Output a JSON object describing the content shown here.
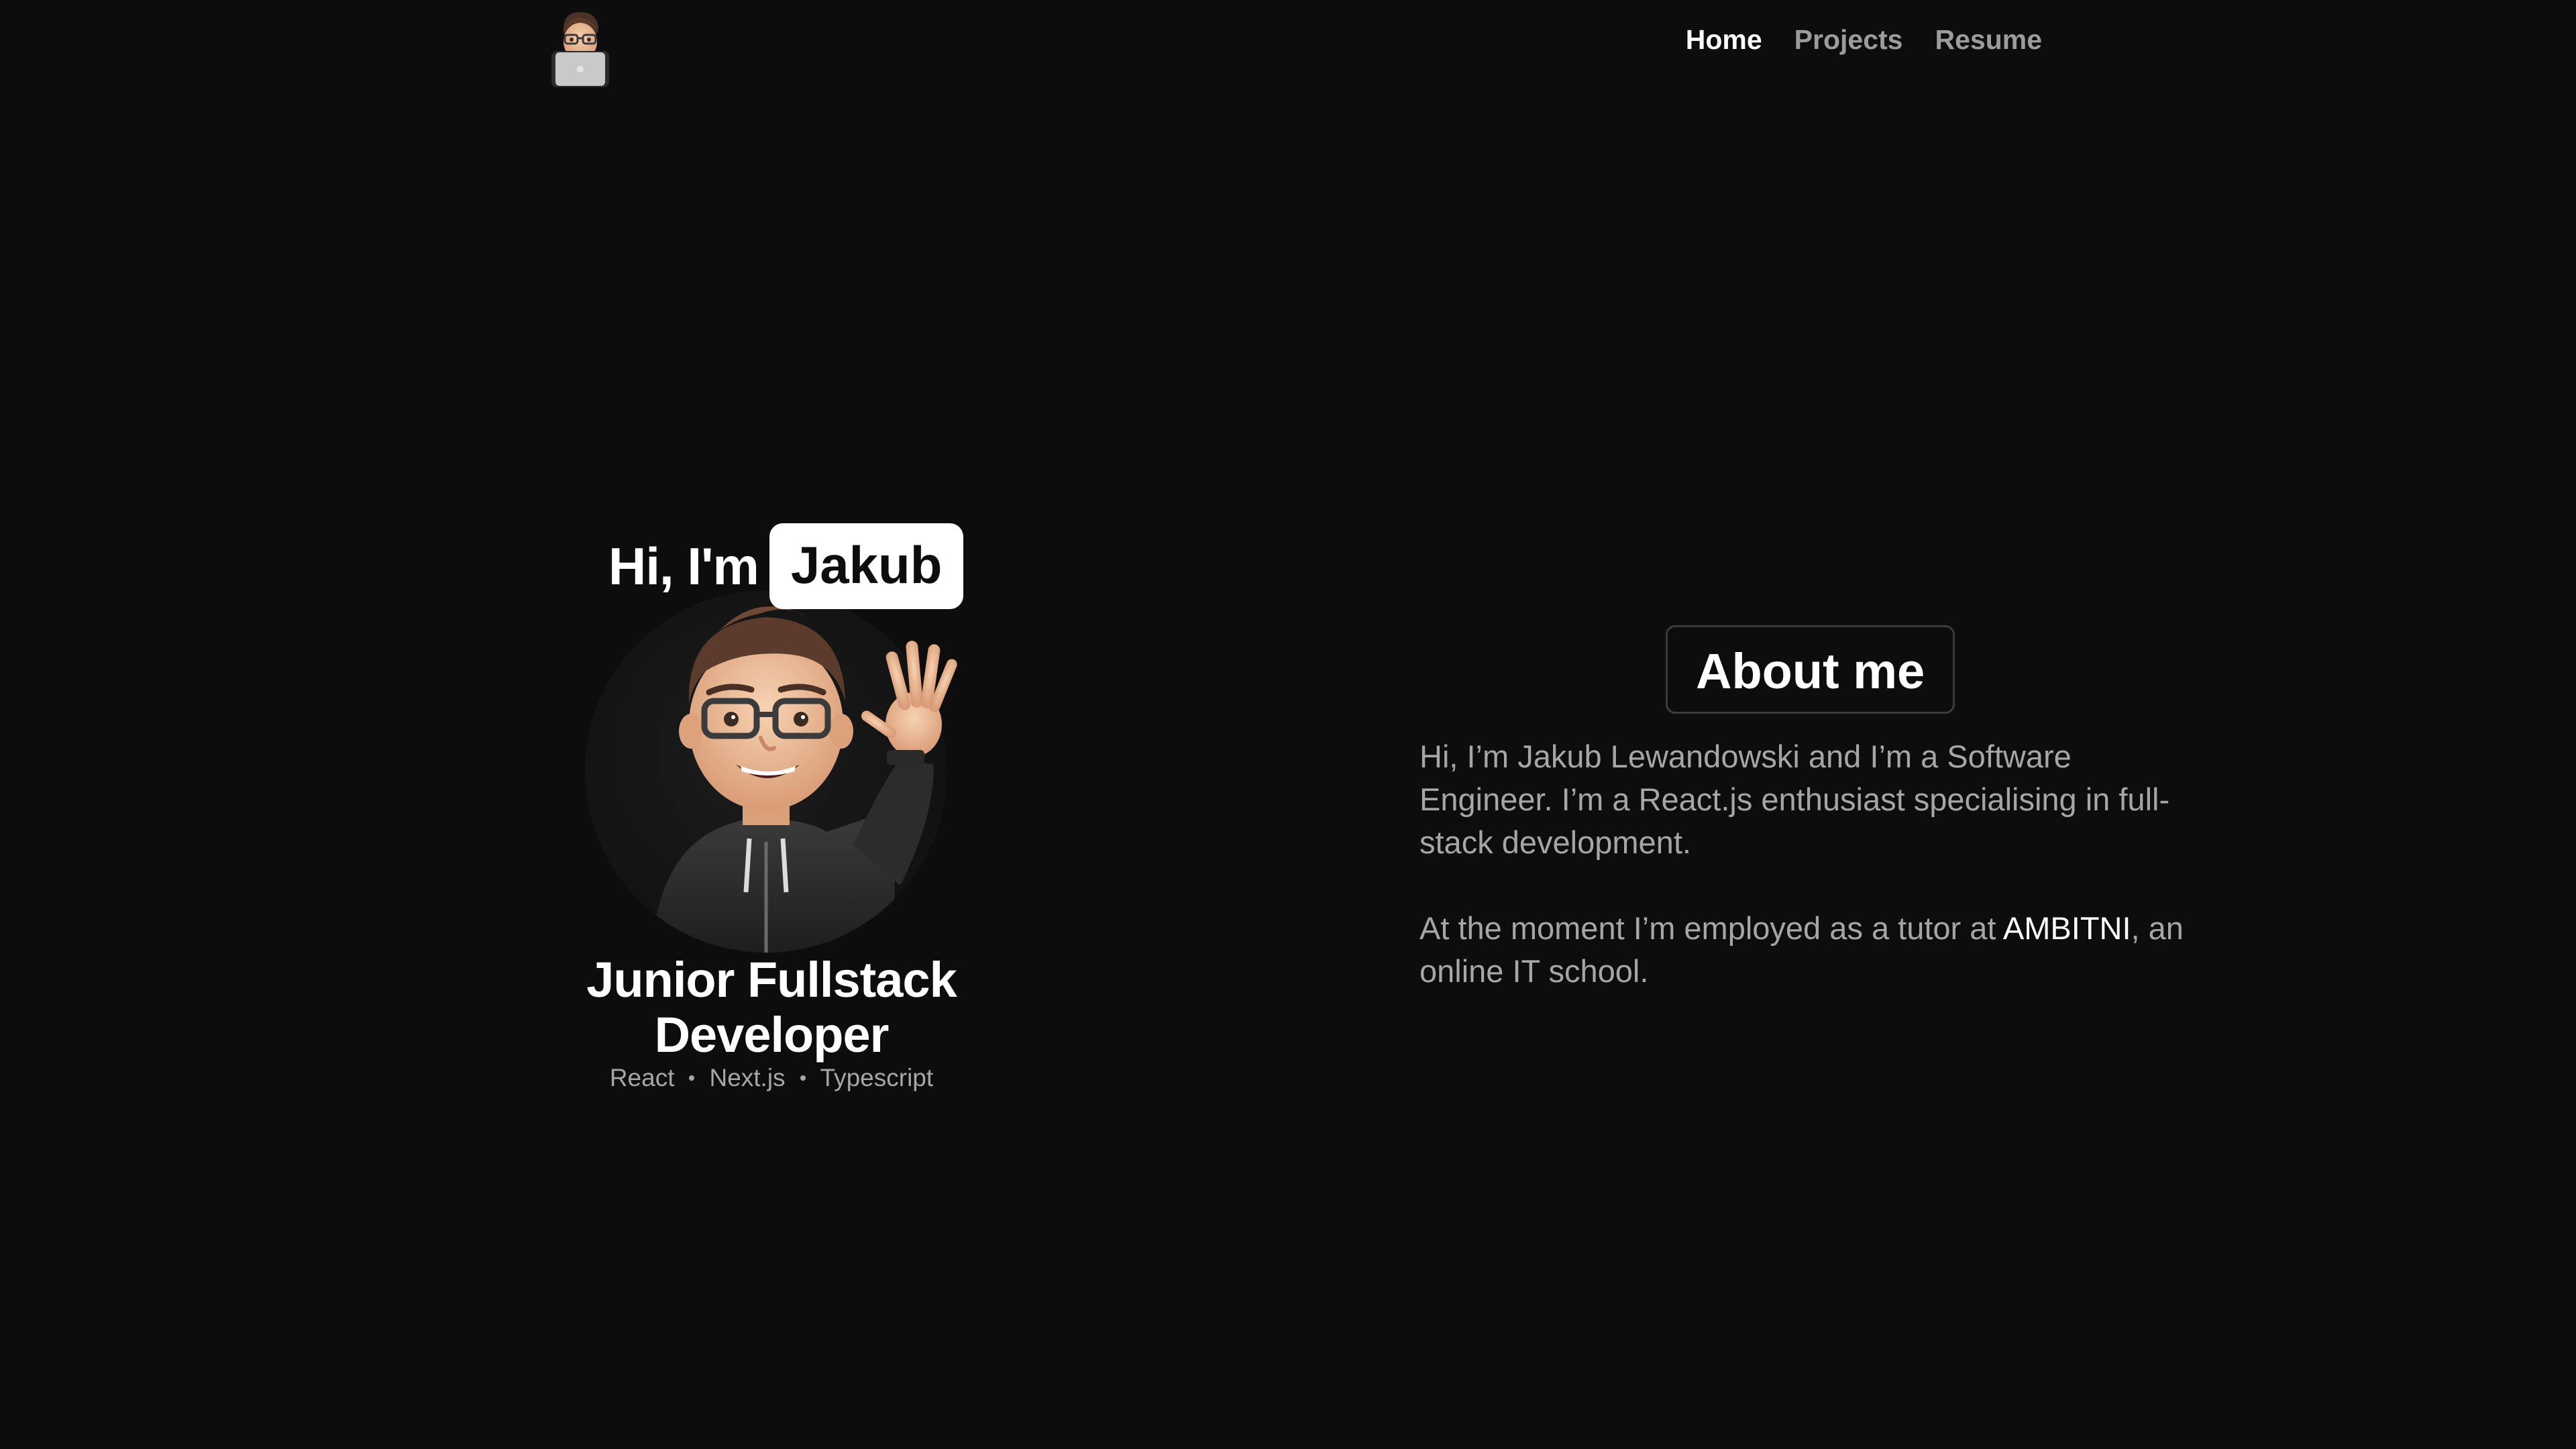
{
  "header": {
    "logo_icon": "memoji-laptop-icon",
    "nav": [
      {
        "label": "Home",
        "active": true
      },
      {
        "label": "Projects",
        "active": false
      },
      {
        "label": "Resume",
        "active": false
      }
    ]
  },
  "hero": {
    "greeting_prefix": "Hi, I'm",
    "name": "Jakub",
    "avatar_icon": "memoji-waving-icon",
    "role_line1": "Junior Fullstack",
    "role_line2": "Developer",
    "stack": [
      "React",
      "Next.js",
      "Typescript"
    ]
  },
  "about": {
    "title": "About me",
    "paragraph1": "Hi, I’m Jakub Lewandowski and I’m a Software Engineer. I’m a React.js enthusiast specialising in full-stack development.",
    "paragraph2_before": "At the moment I’m employed as a tutor at ",
    "paragraph2_link": "AMBITNI",
    "paragraph2_after": ", an online IT school."
  },
  "colors": {
    "background": "#0d0d0d",
    "text_primary": "#ffffff",
    "text_muted": "#a6a6a6",
    "nav_inactive": "#9c9c9c",
    "badge_border": "#3c3c3c"
  }
}
